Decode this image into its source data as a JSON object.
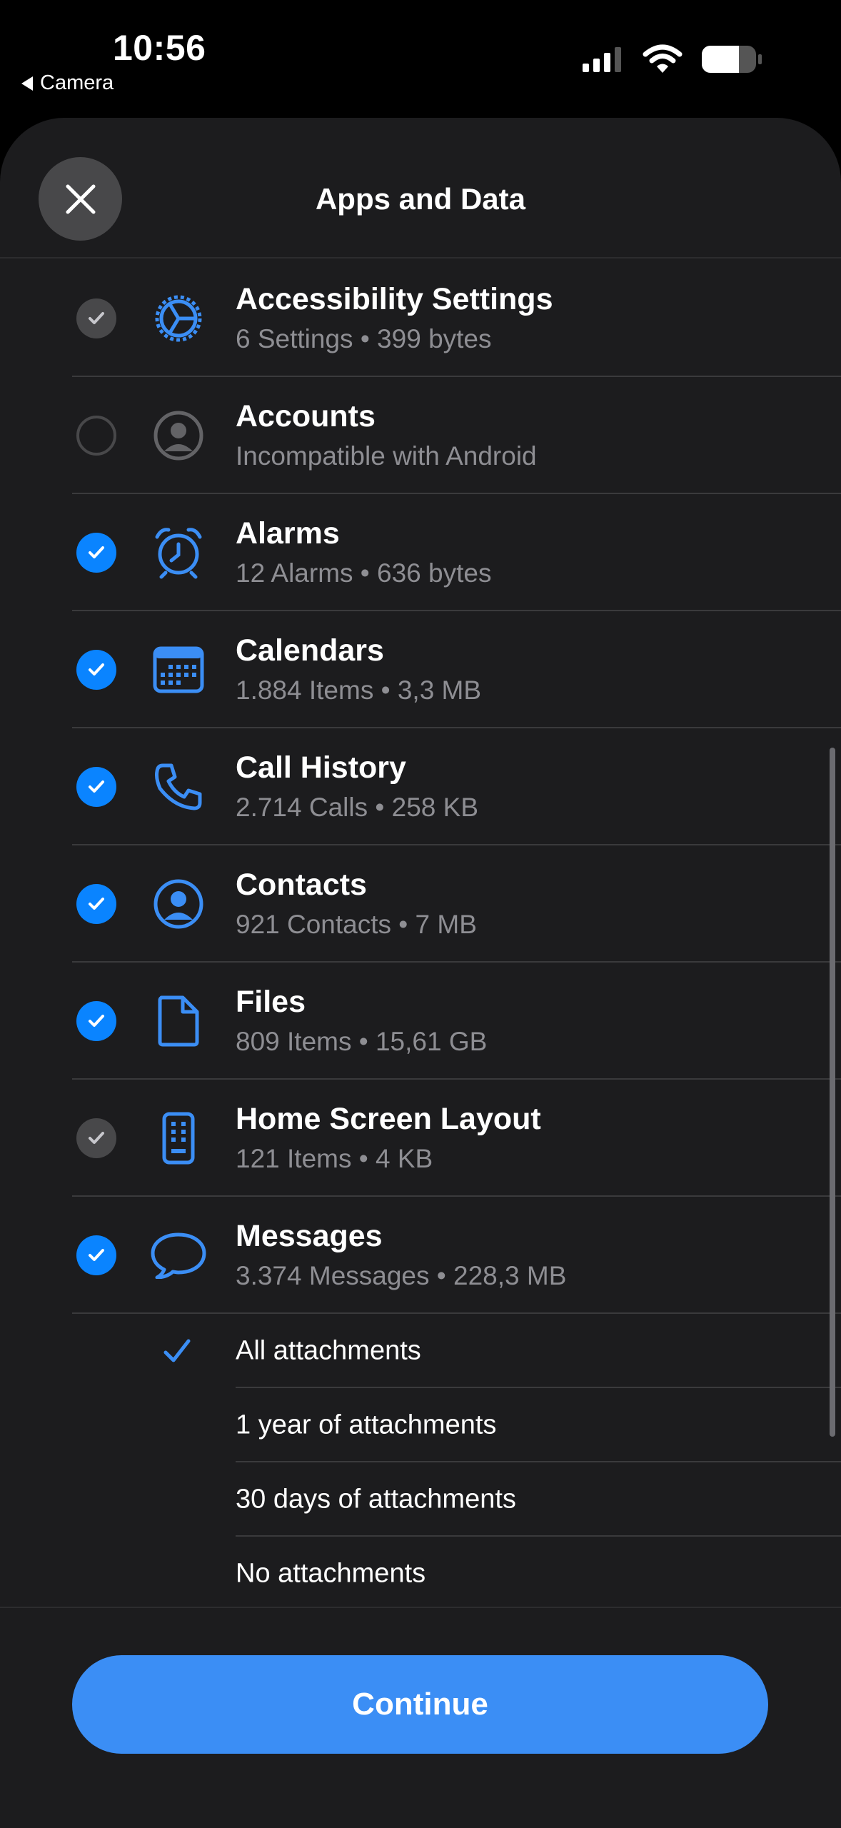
{
  "status": {
    "time": "10:56",
    "back_app": "Camera"
  },
  "sheet": {
    "title": "Apps and Data"
  },
  "items": [
    {
      "title": "Accessibility Settings",
      "subtitle": "6 Settings • 399 bytes",
      "state": "disabled-checked",
      "icon": "gear-icon"
    },
    {
      "title": "Accounts",
      "subtitle": "Incompatible with Android",
      "state": "unchecked",
      "icon": "person-circle-icon"
    },
    {
      "title": "Alarms",
      "subtitle": "12 Alarms • 636 bytes",
      "state": "checked",
      "icon": "alarm-clock-icon"
    },
    {
      "title": "Calendars",
      "subtitle": "1.884 Items • 3,3 MB",
      "state": "checked",
      "icon": "calendar-icon"
    },
    {
      "title": "Call History",
      "subtitle": "2.714 Calls • 258 KB",
      "state": "checked",
      "icon": "phone-icon"
    },
    {
      "title": "Contacts",
      "subtitle": "921 Contacts • 7 MB",
      "state": "checked",
      "icon": "contact-icon"
    },
    {
      "title": "Files",
      "subtitle": "809 Items • 15,61 GB",
      "state": "checked",
      "icon": "file-icon"
    },
    {
      "title": "Home Screen Layout",
      "subtitle": "121 Items • 4 KB",
      "state": "disabled-checked",
      "icon": "phone-device-icon"
    },
    {
      "title": "Messages",
      "subtitle": "3.374 Messages • 228,3 MB",
      "state": "checked",
      "icon": "message-bubble-icon"
    }
  ],
  "attachment_options": [
    {
      "label": "All attachments",
      "selected": true
    },
    {
      "label": "1 year of attachments",
      "selected": false
    },
    {
      "label": "30 days of attachments",
      "selected": false
    },
    {
      "label": "No attachments",
      "selected": false
    }
  ],
  "footer": {
    "continue_label": "Continue"
  },
  "colors": {
    "accent": "#0a84ff",
    "sheet_bg": "#1c1c1e",
    "button": "#3b8ef5"
  }
}
